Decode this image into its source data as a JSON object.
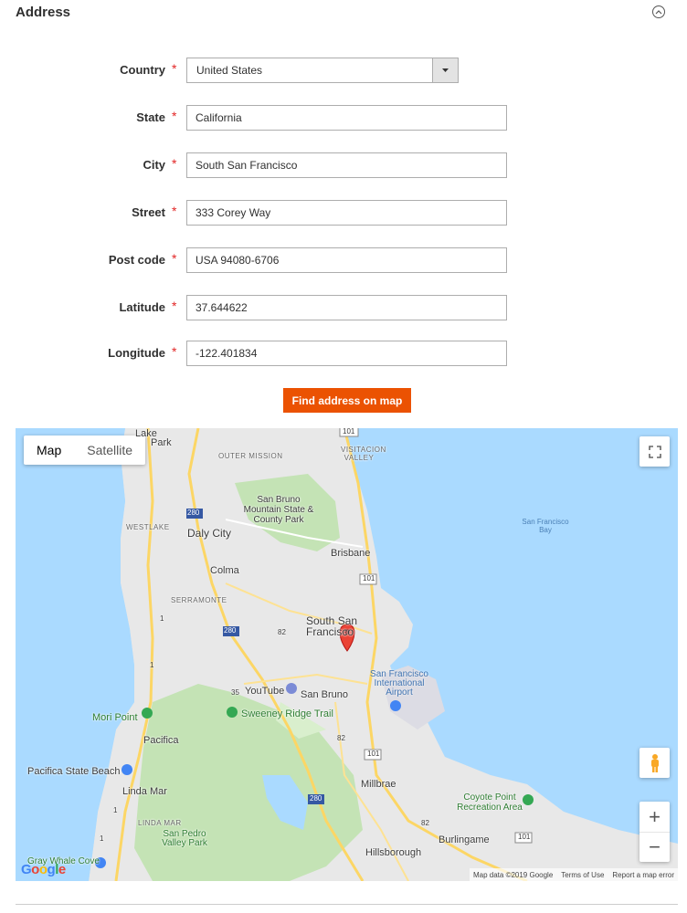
{
  "section": {
    "title": "Address"
  },
  "form": {
    "country": {
      "label": "Country",
      "value": "United States"
    },
    "state": {
      "label": "State",
      "value": "California"
    },
    "city": {
      "label": "City",
      "value": "South San Francisco"
    },
    "street": {
      "label": "Street",
      "value": "333 Corey Way"
    },
    "postcode": {
      "label": "Post code",
      "value": "USA 94080-6706"
    },
    "latitude": {
      "label": "Latitude",
      "value": "37.644622"
    },
    "longitude": {
      "label": "Longitude",
      "value": "-122.401834"
    },
    "required_mark": "*"
  },
  "actions": {
    "find_label": "Find address on map"
  },
  "map": {
    "type_map": "Map",
    "type_satellite": "Satellite",
    "zoom_in": "+",
    "zoom_out": "−",
    "places": {
      "lake": "Lake",
      "park": "Park",
      "outer_mission": "OUTER MISSION",
      "visitacion_valley": "VISITACION VALLEY",
      "san_bruno_park": "San Bruno Mountain State & County Park",
      "westlake": "WESTLAKE",
      "daly_city": "Daly City",
      "sf_bay": "San Francisco Bay",
      "brisbane": "Brisbane",
      "colma": "Colma",
      "serramonte": "SERRAMONTE",
      "south_sf": "South San Francisco",
      "youtube": "YouTube",
      "san_bruno": "San Bruno",
      "sfo": "San Francisco International Airport",
      "mori_point": "Mori Point",
      "sweeney": "Sweeney Ridge Trail",
      "pacifica": "Pacifica",
      "pacifica_beach": "Pacifica State Beach",
      "linda_mar": "Linda Mar",
      "millbrae": "Millbrae",
      "coyote_point": "Coyote Point Recreation Area",
      "linda_mar_caps": "LINDA MAR",
      "san_pedro": "San Pedro Valley Park",
      "burlingame": "Burlingame",
      "hillsborough": "Hillsborough",
      "gray_whale": "Gray Whale Cove State Beach"
    },
    "highways": [
      "101",
      "280",
      "1",
      "35",
      "82"
    ],
    "attribution": {
      "data": "Map data ©2019 Google",
      "terms": "Terms of Use",
      "report": "Report a map error"
    },
    "google": "Google"
  },
  "colors": {
    "accent": "#eb5202",
    "required": "#e22626",
    "water": "#aadaff",
    "land": "#e8e8e8",
    "park": "#c4e3b5",
    "road": "#fcd665"
  }
}
